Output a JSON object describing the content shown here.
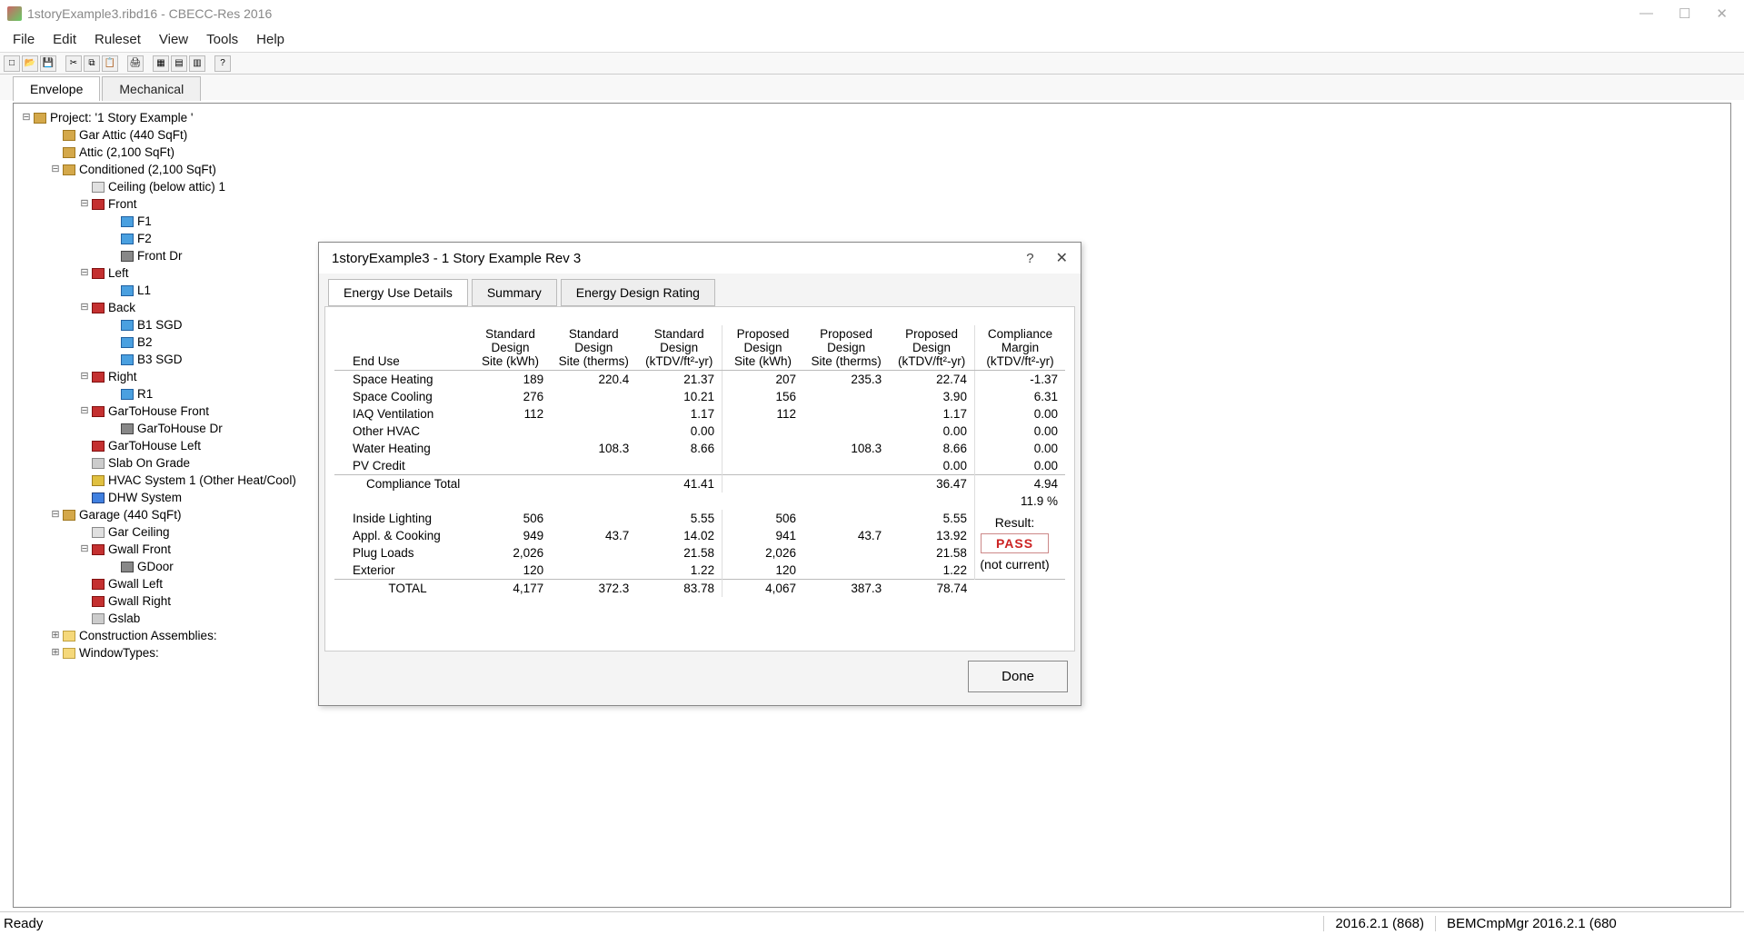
{
  "window": {
    "title": "1storyExample3.ribd16 - CBECC-Res 2016"
  },
  "menu": [
    "File",
    "Edit",
    "Ruleset",
    "View",
    "Tools",
    "Help"
  ],
  "tabs": {
    "envelope": "Envelope",
    "mechanical": "Mechanical"
  },
  "tree": [
    {
      "ind": 0,
      "exp": "-",
      "ic": "ic-proj",
      "label": "Project:  '1 Story Example '"
    },
    {
      "ind": 1,
      "exp": "",
      "ic": "ic-zone",
      "label": "Gar Attic   (440 SqFt)"
    },
    {
      "ind": 1,
      "exp": "",
      "ic": "ic-zone",
      "label": "Attic   (2,100 SqFt)"
    },
    {
      "ind": 1,
      "exp": "-",
      "ic": "ic-zone",
      "label": "Conditioned  (2,100 SqFt)"
    },
    {
      "ind": 2,
      "exp": "",
      "ic": "ic-ceil",
      "label": "Ceiling (below attic) 1"
    },
    {
      "ind": 2,
      "exp": "-",
      "ic": "ic-wall",
      "label": "Front"
    },
    {
      "ind": 3,
      "exp": "",
      "ic": "ic-win",
      "label": "F1"
    },
    {
      "ind": 3,
      "exp": "",
      "ic": "ic-win",
      "label": "F2"
    },
    {
      "ind": 3,
      "exp": "",
      "ic": "ic-door",
      "label": "Front Dr"
    },
    {
      "ind": 2,
      "exp": "-",
      "ic": "ic-wall",
      "label": "Left"
    },
    {
      "ind": 3,
      "exp": "",
      "ic": "ic-win",
      "label": "L1"
    },
    {
      "ind": 2,
      "exp": "-",
      "ic": "ic-wall",
      "label": "Back"
    },
    {
      "ind": 3,
      "exp": "",
      "ic": "ic-win",
      "label": "B1 SGD"
    },
    {
      "ind": 3,
      "exp": "",
      "ic": "ic-win",
      "label": "B2"
    },
    {
      "ind": 3,
      "exp": "",
      "ic": "ic-win",
      "label": "B3 SGD"
    },
    {
      "ind": 2,
      "exp": "-",
      "ic": "ic-wall",
      "label": "Right"
    },
    {
      "ind": 3,
      "exp": "",
      "ic": "ic-win",
      "label": "R1"
    },
    {
      "ind": 2,
      "exp": "-",
      "ic": "ic-wall",
      "label": "GarToHouse Front"
    },
    {
      "ind": 3,
      "exp": "",
      "ic": "ic-door",
      "label": "GarToHouse Dr"
    },
    {
      "ind": 2,
      "exp": "",
      "ic": "ic-wall",
      "label": "GarToHouse Left"
    },
    {
      "ind": 2,
      "exp": "",
      "ic": "ic-slab",
      "label": "Slab On Grade"
    },
    {
      "ind": 2,
      "exp": "",
      "ic": "ic-hvac",
      "label": "HVAC System 1  (Other Heat/Cool)"
    },
    {
      "ind": 2,
      "exp": "",
      "ic": "ic-dhw",
      "label": "DHW System"
    },
    {
      "ind": 1,
      "exp": "-",
      "ic": "ic-zone",
      "label": "Garage  (440 SqFt)"
    },
    {
      "ind": 2,
      "exp": "",
      "ic": "ic-ceil",
      "label": "Gar Ceiling"
    },
    {
      "ind": 2,
      "exp": "-",
      "ic": "ic-wall",
      "label": "Gwall Front"
    },
    {
      "ind": 3,
      "exp": "",
      "ic": "ic-door",
      "label": "GDoor"
    },
    {
      "ind": 2,
      "exp": "",
      "ic": "ic-wall",
      "label": "Gwall Left"
    },
    {
      "ind": 2,
      "exp": "",
      "ic": "ic-wall",
      "label": "Gwall Right"
    },
    {
      "ind": 2,
      "exp": "",
      "ic": "ic-slab",
      "label": "Gslab"
    },
    {
      "ind": 1,
      "exp": "+",
      "ic": "ic-fold",
      "label": "Construction Assemblies:"
    },
    {
      "ind": 1,
      "exp": "+",
      "ic": "ic-fold",
      "label": "WindowTypes:"
    }
  ],
  "dialog": {
    "title": "1storyExample3 - 1 Story Example Rev 3",
    "tabs": {
      "details": "Energy Use Details",
      "summary": "Summary",
      "rating": "Energy Design Rating"
    },
    "headers": {
      "enduse": "End Use",
      "std_kwh": "Standard Design Site (kWh)",
      "std_therms": "Standard Design Site (therms)",
      "std_tdv": "Standard Design (kTDV/ft²-yr)",
      "prop_kwh": "Proposed Design Site (kWh)",
      "prop_therms": "Proposed Design Site (therms)",
      "prop_tdv": "Proposed Design (kTDV/ft²-yr)",
      "margin": "Compliance Margin (kTDV/ft²-yr)"
    },
    "rows": [
      {
        "label": "Space Heating",
        "v": [
          "189",
          "220.4",
          "21.37",
          "207",
          "235.3",
          "22.74",
          "-1.37"
        ]
      },
      {
        "label": "Space Cooling",
        "v": [
          "276",
          "",
          "10.21",
          "156",
          "",
          "3.90",
          "6.31"
        ]
      },
      {
        "label": "IAQ Ventilation",
        "v": [
          "112",
          "",
          "1.17",
          "112",
          "",
          "1.17",
          "0.00"
        ]
      },
      {
        "label": "Other HVAC",
        "v": [
          "",
          "",
          "0.00",
          "",
          "",
          "0.00",
          "0.00"
        ]
      },
      {
        "label": "Water Heating",
        "v": [
          "",
          "108.3",
          "8.66",
          "",
          "108.3",
          "8.66",
          "0.00"
        ]
      },
      {
        "label": "PV Credit",
        "v": [
          "",
          "",
          "",
          "",
          "",
          "0.00",
          "0.00"
        ]
      }
    ],
    "compliance": {
      "label": "Compliance Total",
      "std": "41.41",
      "prop": "36.47",
      "margin": "4.94"
    },
    "pct": "11.9 %",
    "rows2": [
      {
        "label": "Inside Lighting",
        "v": [
          "506",
          "",
          "5.55",
          "506",
          "",
          "5.55"
        ]
      },
      {
        "label": "Appl. & Cooking",
        "v": [
          "949",
          "43.7",
          "14.02",
          "941",
          "43.7",
          "13.92"
        ]
      },
      {
        "label": "Plug Loads",
        "v": [
          "2,026",
          "",
          "21.58",
          "2,026",
          "",
          "21.58"
        ]
      },
      {
        "label": "Exterior",
        "v": [
          "120",
          "",
          "1.22",
          "120",
          "",
          "1.22"
        ]
      }
    ],
    "total": {
      "label": "TOTAL",
      "v": [
        "4,177",
        "372.3",
        "83.78",
        "4,067",
        "387.3",
        "78.74"
      ]
    },
    "result_label": "Result:",
    "result_value": "PASS",
    "result_note": "(not current)",
    "done": "Done"
  },
  "status": {
    "ready": "Ready",
    "ver": "2016.2.1 (868)",
    "bem": "BEMCmpMgr 2016.2.1 (680"
  }
}
